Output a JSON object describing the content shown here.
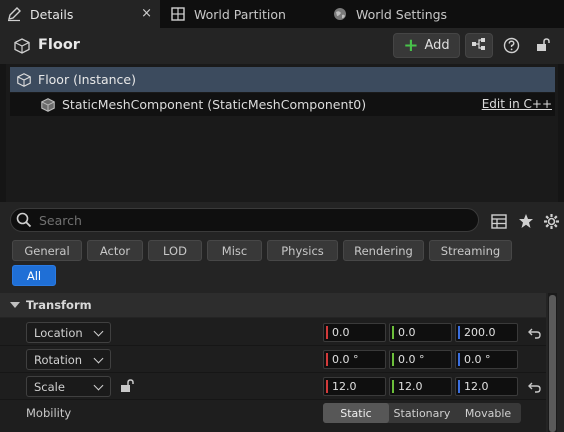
{
  "tabs": [
    {
      "label": "Details",
      "icon": "pencil-icon",
      "active": true,
      "close": "×"
    },
    {
      "label": "World Partition",
      "icon": "grid-icon",
      "active": false
    },
    {
      "label": "World Settings",
      "icon": "globe-icon",
      "active": false
    }
  ],
  "header": {
    "title": "Floor",
    "add_label": "Add"
  },
  "tree": {
    "root": "Floor (Instance)",
    "child": "StaticMeshComponent (StaticMeshComponent0)",
    "edit_link": "Edit in C++"
  },
  "search": {
    "placeholder": "Search"
  },
  "filters": [
    "General",
    "Actor",
    "LOD",
    "Misc",
    "Physics",
    "Rendering",
    "Streaming"
  ],
  "filter_all": "All",
  "transform": {
    "title": "Transform",
    "location": {
      "label": "Location",
      "x": "0.0",
      "y": "0.0",
      "z": "200.0"
    },
    "rotation": {
      "label": "Rotation",
      "x": "0.0 °",
      "y": "0.0 °",
      "z": "0.0 °"
    },
    "scale": {
      "label": "Scale",
      "x": "12.0",
      "y": "12.0",
      "z": "12.0"
    },
    "mobility": {
      "label": "Mobility",
      "options": [
        "Static",
        "Stationary",
        "Movable"
      ],
      "selected": "Static"
    }
  },
  "colors": {
    "axis_x": "#d23a3a",
    "axis_y": "#6cbf3b",
    "axis_z": "#3a6fe0",
    "accent": "#1f6fd6",
    "selection": "#3c4b5e",
    "add_plus": "#48c24a"
  }
}
